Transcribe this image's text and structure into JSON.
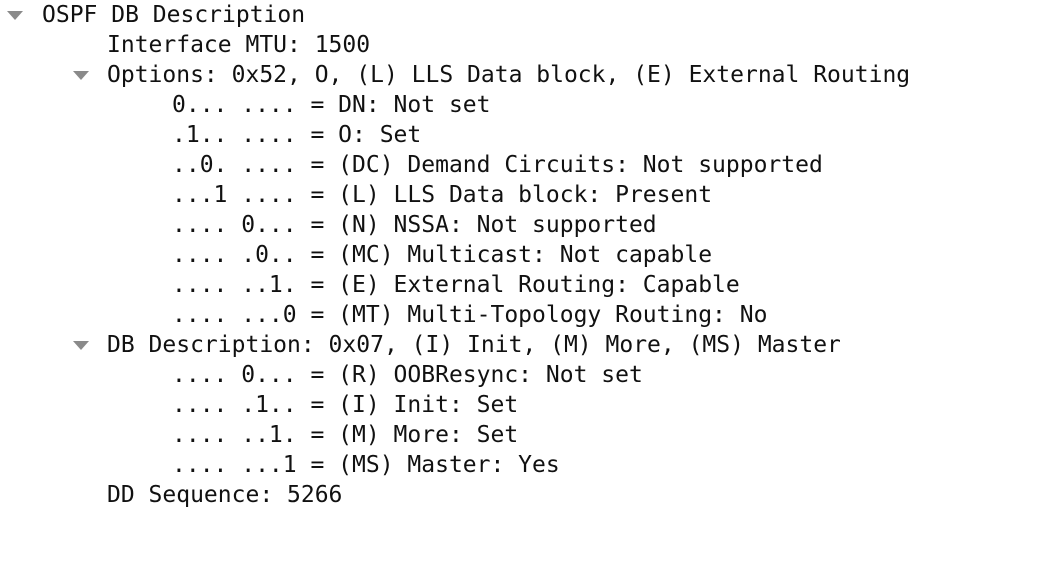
{
  "tree": {
    "root": {
      "label": "OSPF DB Description",
      "expanded": true,
      "toggle_icon": "disclosure-triangle-expanded-icon"
    },
    "interface_mtu": "Interface MTU: 1500",
    "options": {
      "label": "Options: 0x52, O, (L) LLS Data block, (E) External Routing",
      "expanded": true,
      "toggle_icon": "disclosure-triangle-expanded-icon",
      "bits": [
        "0... .... = DN: Not set",
        ".1.. .... = O: Set",
        "..0. .... = (DC) Demand Circuits: Not supported",
        "...1 .... = (L) LLS Data block: Present",
        ".... 0... = (N) NSSA: Not supported",
        ".... .0.. = (MC) Multicast: Not capable",
        ".... ..1. = (E) External Routing: Capable",
        ".... ...0 = (MT) Multi-Topology Routing: No"
      ]
    },
    "db_description": {
      "label": "DB Description: 0x07, (I) Init, (M) More, (MS) Master",
      "expanded": true,
      "toggle_icon": "disclosure-triangle-expanded-icon",
      "bits": [
        ".... 0... = (R) OOBResync: Not set",
        ".... .1.. = (I) Init: Set",
        ".... ..1. = (M) More: Set",
        ".... ...1 = (MS) Master: Yes"
      ]
    },
    "dd_sequence": "DD Sequence: 5266"
  }
}
